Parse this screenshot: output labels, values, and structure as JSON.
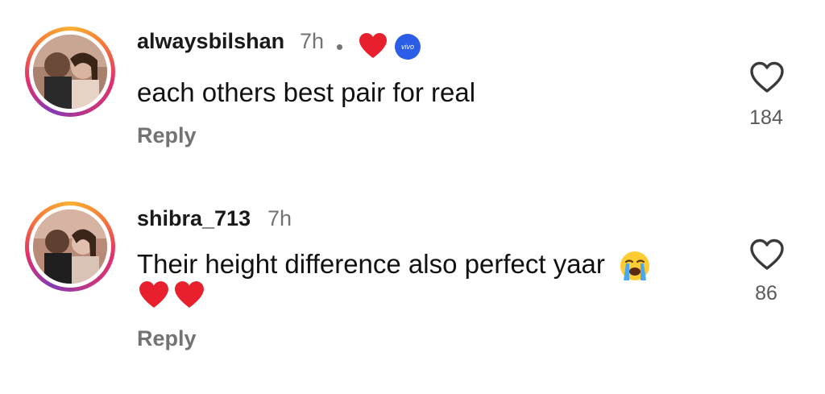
{
  "comments": [
    {
      "username": "alwaysbilshan",
      "time": "7h",
      "text": "each others best pair for real",
      "reply_label": "Reply",
      "like_count": "184",
      "liked_by_creator": true,
      "badge_text": "vivo"
    },
    {
      "username": "shibra_713",
      "time": "7h",
      "text": "Their height difference also perfect yaar",
      "reply_label": "Reply",
      "like_count": "86"
    }
  ],
  "colors": {
    "heart_red": "#e8202e",
    "muted_text": "#737373",
    "badge_blue": "#2b5de8"
  },
  "icons": {
    "like": "heart-outline-icon",
    "creator_like": "red-heart-icon",
    "emoji": "loudly-crying-face-icon"
  }
}
